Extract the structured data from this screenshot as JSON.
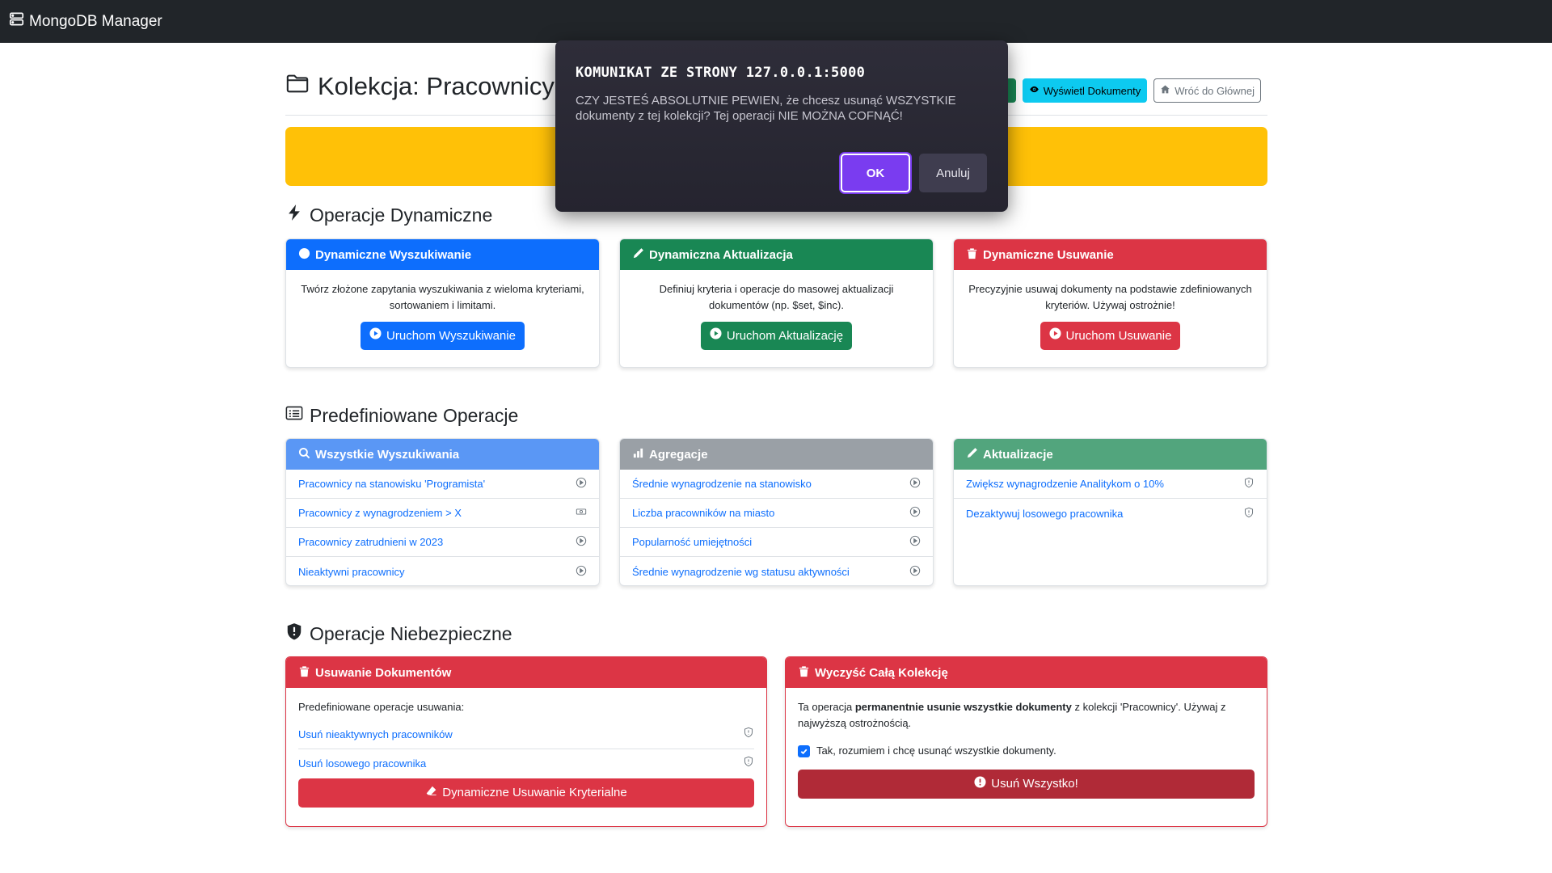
{
  "navbar": {
    "brand": "MongoDB Manager"
  },
  "header": {
    "title": "Kolekcja: Pracownicy",
    "view_docs": "Wyświetl Dokumenty",
    "back_home": "Wróć do Głównej"
  },
  "sections": {
    "dynamic": "Operacje Dynamiczne",
    "predefined": "Predefiniowane Operacje",
    "dangerous": "Operacje Niebezpieczne"
  },
  "dynamic_cards": [
    {
      "title": "Dynamiczne Wyszukiwanie",
      "desc": "Twórz złożone zapytania wyszukiwania z wieloma kryteriami, sortowaniem i limitami.",
      "button": "Uruchom Wyszukiwanie"
    },
    {
      "title": "Dynamiczna Aktualizacja",
      "desc": "Definiuj kryteria i operacje do masowej aktualizacji dokumentów (np. $set, $inc).",
      "button": "Uruchom Aktualizację"
    },
    {
      "title": "Dynamiczne Usuwanie",
      "desc": "Precyzyjnie usuwaj dokumenty na podstawie zdefiniowanych kryteriów. Używaj ostrożnie!",
      "button": "Uruchom Usuwanie"
    }
  ],
  "predefined_cards": [
    {
      "title": "Wszystkie Wyszukiwania",
      "items": [
        "Pracownicy na stanowisku 'Programista'",
        "Pracownicy z wynagrodzeniem > X",
        "Pracownicy zatrudnieni w 2023",
        "Nieaktywni pracownicy"
      ]
    },
    {
      "title": "Agregacje",
      "items": [
        "Średnie wynagrodzenie na stanowisko",
        "Liczba pracowników na miasto",
        "Popularność umiejętności",
        "Średnie wynagrodzenie wg statusu aktywności"
      ]
    },
    {
      "title": "Aktualizacje",
      "items": [
        "Zwiększ wynagrodzenie Analitykom o 10%",
        "Dezaktywuj losowego pracownika"
      ]
    }
  ],
  "delete_docs": {
    "title": "Usuwanie Dokumentów",
    "intro": "Predefiniowane operacje usuwania:",
    "items": [
      "Usuń nieaktywnych pracowników",
      "Usuń losowego pracownika"
    ],
    "button": "Dynamiczne Usuwanie Kryterialne"
  },
  "clear_all": {
    "title": "Wyczyść Całą Kolekcję",
    "text_pre": "Ta operacja ",
    "text_bold": "permanentnie usunie wszystkie dokumenty",
    "text_post": " z kolekcji 'Pracownicy'. Używaj z najwyższą ostrożnością.",
    "confirm": "Tak, rozumiem i chcę usunąć wszystkie dokumenty.",
    "button": "Usuń Wszystko!"
  },
  "dialog": {
    "title": "KOMUNIKAT ZE STRONY 127.0.0.1:5000",
    "message": "CZY JESTEŚ ABSOLUTNIE PEWIEN, że chcesz usunąć WSZYSTKIE dokumenty z tej kolekcji? Tej operacji NIE MOŻNA COFNĄĆ!",
    "ok": "OK",
    "cancel": "Anuluj"
  }
}
